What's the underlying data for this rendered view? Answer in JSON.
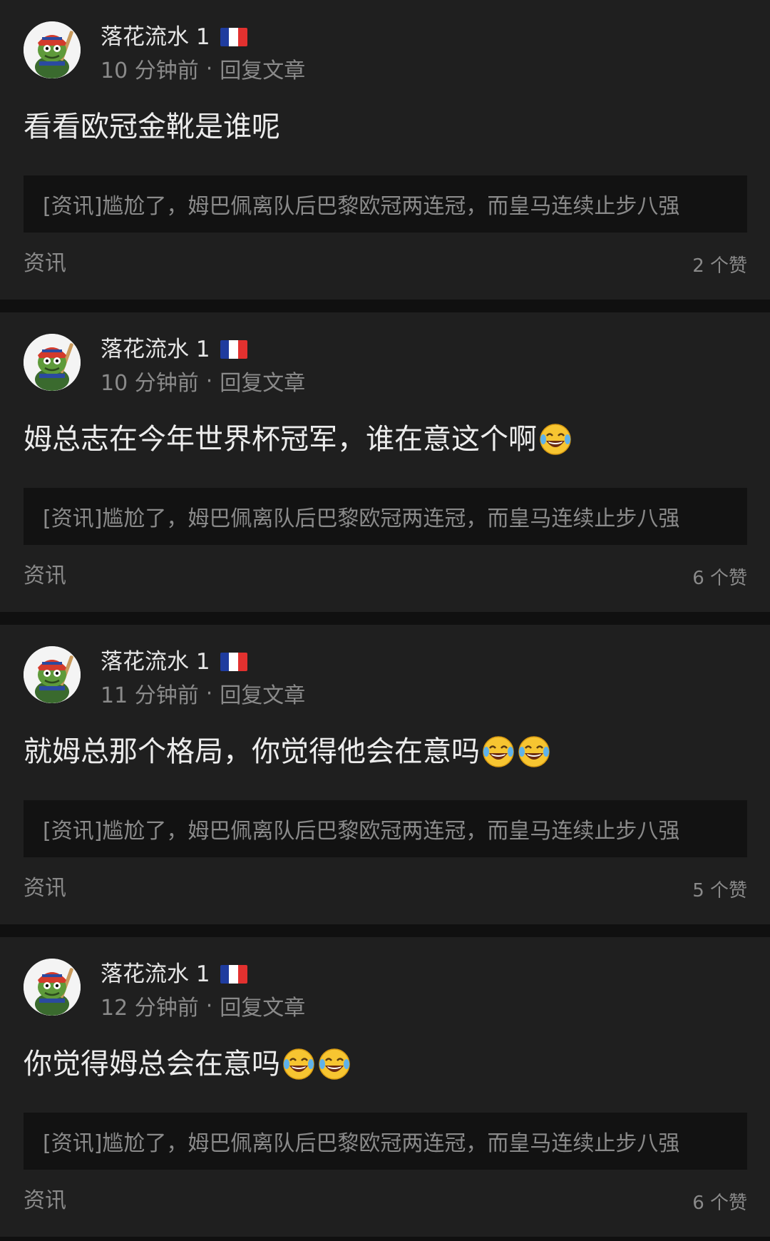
{
  "posts": [
    {
      "username": "落花流水 1",
      "time": "10 分钟前",
      "dot": "·",
      "action": "回复文章",
      "content": "看看欧冠金靴是谁呢",
      "emoji_count": 0,
      "article": "[资讯]尴尬了，姆巴佩离队后巴黎欧冠两连冠，而皇马连续止步八强",
      "category": "资讯",
      "likes": "2 个赞"
    },
    {
      "username": "落花流水 1",
      "time": "10 分钟前",
      "dot": "·",
      "action": "回复文章",
      "content": "姆总志在今年世界杯冠军，谁在意这个啊",
      "emoji_count": 1,
      "article": "[资讯]尴尬了，姆巴佩离队后巴黎欧冠两连冠，而皇马连续止步八强",
      "category": "资讯",
      "likes": "6 个赞"
    },
    {
      "username": "落花流水 1",
      "time": "11 分钟前",
      "dot": "·",
      "action": "回复文章",
      "content": "就姆总那个格局，你觉得他会在意吗",
      "emoji_count": 2,
      "article": "[资讯]尴尬了，姆巴佩离队后巴黎欧冠两连冠，而皇马连续止步八强",
      "category": "资讯",
      "likes": "5 个赞"
    },
    {
      "username": "落花流水 1",
      "time": "12 分钟前",
      "dot": "·",
      "action": "回复文章",
      "content": "你觉得姆总会在意吗",
      "emoji_count": 2,
      "article": "[资讯]尴尬了，姆巴佩离队后巴黎欧冠两连冠，而皇马连续止步八强",
      "category": "资讯",
      "likes": "6 个赞"
    }
  ],
  "icons": {
    "avatar": "frog-avatar-icon",
    "flag": "france-flag-icon",
    "emoji": "tears-of-joy-emoji-icon"
  },
  "colors": {
    "background": "#101010",
    "card": "#1f1f1f",
    "article_box": "#121212",
    "primary_text": "#ececec",
    "secondary_text": "#8a8a8a",
    "flag_blue": "#1f3c9e",
    "flag_white": "#ffffff",
    "flag_red": "#e2312f"
  }
}
